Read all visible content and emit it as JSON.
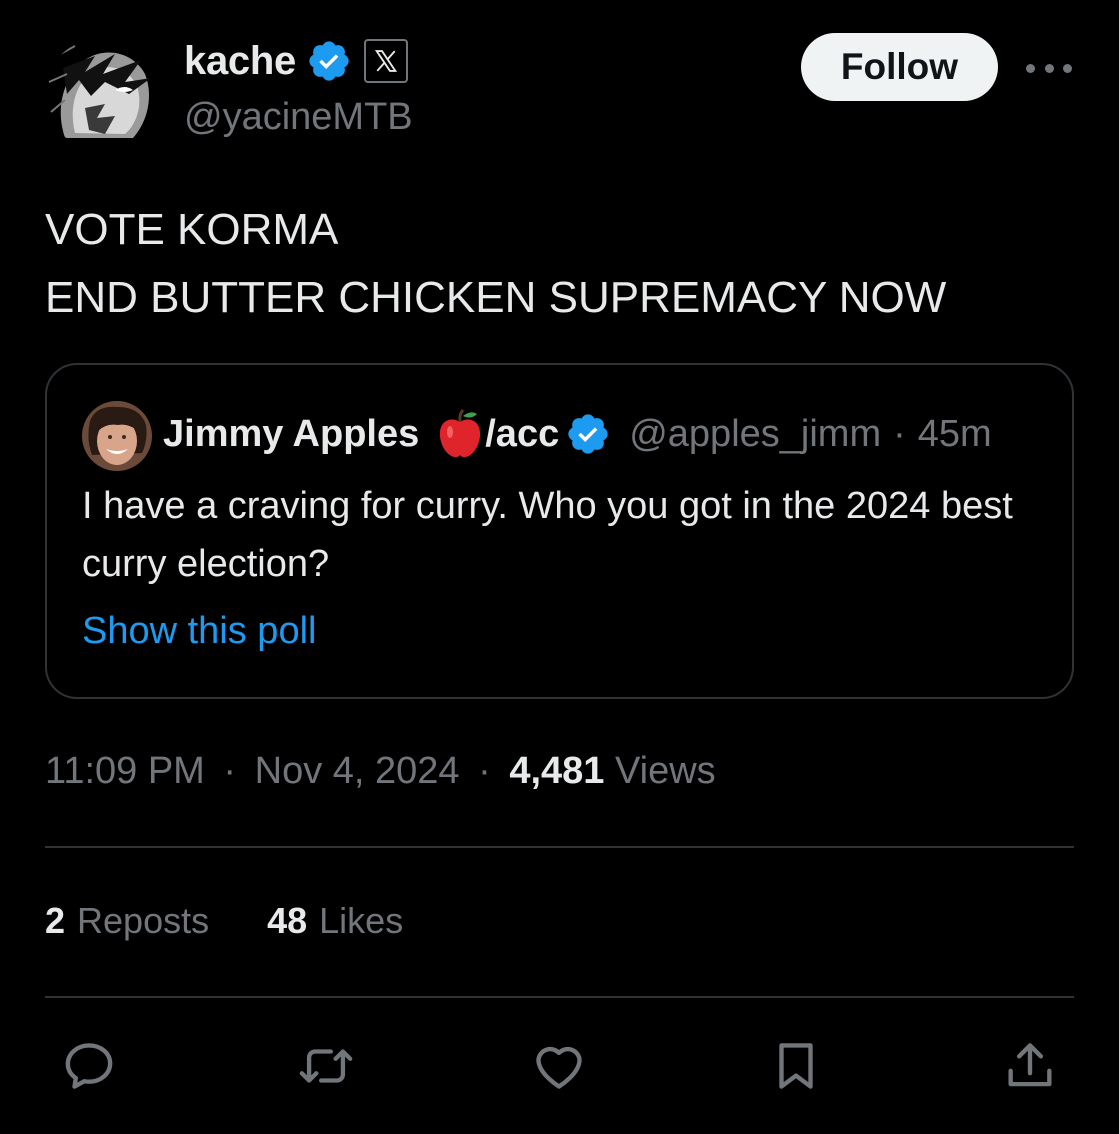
{
  "author": {
    "display_name": "kache",
    "handle": "@yacineMTB",
    "verified_icon": "verified-badge-icon",
    "affiliation_icon": "x-logo-icon"
  },
  "header": {
    "follow_label": "Follow",
    "more_icon": "more-dots-icon"
  },
  "tweet": {
    "lines": [
      "VOTE KORMA",
      "END BUTTER CHICKEN SUPREMACY NOW"
    ]
  },
  "quote": {
    "display_name": "Jimmy Apples",
    "emoji": "apple-icon",
    "name_suffix": "/acc",
    "handle": "@apples_jimm",
    "separator": "·",
    "time": "45m",
    "text": "I have a craving for curry. Who you got in the 2024 best curry election?",
    "link_label": "Show this poll"
  },
  "meta": {
    "time": "11:09 PM",
    "date": "Nov 4, 2024",
    "views_count": "4,481",
    "views_label": "Views",
    "separator": "·"
  },
  "stats": {
    "reposts_count": "2",
    "reposts_label": "Reposts",
    "likes_count": "48",
    "likes_label": "Likes"
  },
  "actions": [
    "reply-icon",
    "repost-icon",
    "like-icon",
    "bookmark-icon",
    "share-icon"
  ],
  "colors": {
    "background": "#000000",
    "text": "#e7e9ea",
    "muted": "#71767b",
    "accent": "#1d9bf0",
    "border": "#2f3336"
  }
}
